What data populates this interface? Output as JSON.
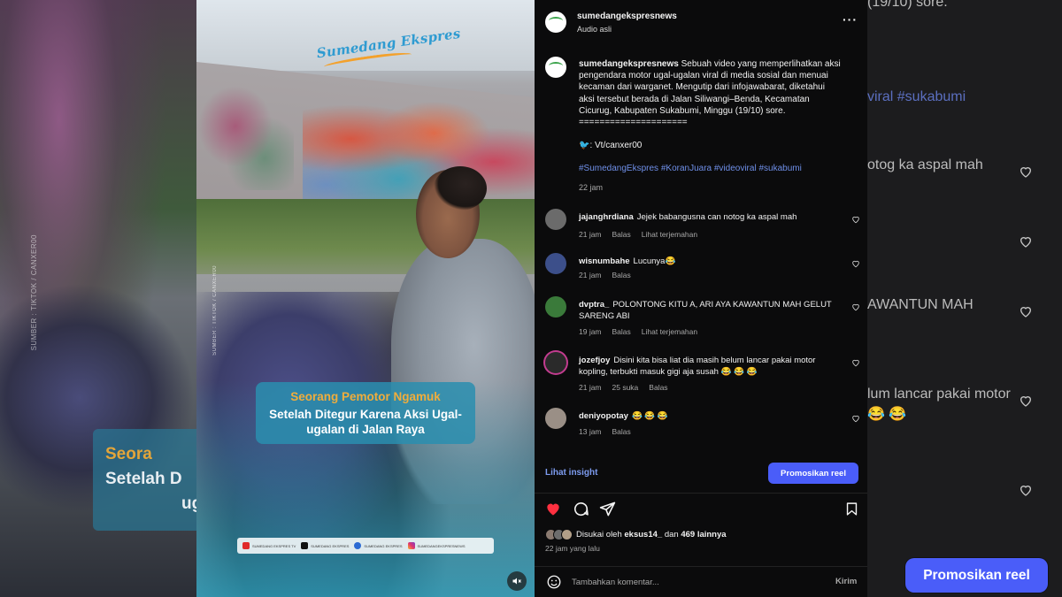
{
  "background_left": {
    "overlay_line1": "Seora",
    "overlay_line2": "Setelah D",
    "overlay_line3": "ug",
    "side_credit": "SUMBER : TIKTOK / CANXER00"
  },
  "video": {
    "brand_logo": "Sumedang Ekspres",
    "side_credit": "SUMBER : TIKTOK / CANXER00",
    "caption_title": "Seorang Pemotor Ngamuk",
    "caption_body_1": "Setelah Ditegur Karena Aksi Ugal-",
    "caption_body_2": "ugalan di Jalan Raya",
    "socials": [
      {
        "icon": "youtube-icon",
        "label": "SUMEDANG EKSPRES TV"
      },
      {
        "icon": "tiktok-icon",
        "label": "SUMEDANG EKSPRES"
      },
      {
        "icon": "facebook-icon",
        "label": "SUMEDANG EKSPRES"
      },
      {
        "icon": "instagram-icon",
        "label": "SUMEDANGEKSPRESNEWS"
      }
    ],
    "mute_icon": "speaker-muted-icon"
  },
  "header": {
    "username": "sumedangekspresnews",
    "audio": "Audio asli",
    "more": "···"
  },
  "post": {
    "username": "sumedangekspresnews",
    "caption_lines": [
      "Sebuah video yang memperlihatkan aksi",
      "pengendara motor ugal-ugalan viral di media sosial dan menuai",
      "kecaman dari warganet. Mengutip dari infojawabarat, diketahui",
      "aksi tersebut berada di Jalan Siliwangi–Benda, Kecamatan",
      "Cicurug, Kabupaten Sukabumi, Minggu (19/10) sore.",
      "====================="
    ],
    "credit": "🐦: Vt/canxer00",
    "hashtags": "#SumedangEkspres #KoranJuara #videoviral #sukabumi",
    "time": "22 jam"
  },
  "comments": [
    {
      "user": "jajanghrdiana",
      "text": "Jejek babangusna can notog ka aspal mah",
      "time": "21 jam",
      "likes": "",
      "reply": "Balas",
      "translate": "Lihat terjemahan",
      "avatar_color": "#6b6b6b"
    },
    {
      "user": "wisnumbahe",
      "text": "Lucunya😂",
      "time": "21 jam",
      "likes": "",
      "reply": "Balas",
      "translate": "",
      "avatar_color": "#3c4f8a"
    },
    {
      "user": "dvptra_",
      "text": "POLONTONG KITU A, ARI AYA KAWANTUN MAH GELUT SARENG ABI",
      "time": "19 jam",
      "likes": "",
      "reply": "Balas",
      "translate": "Lihat terjemahan",
      "avatar_color": "#3a7a3a"
    },
    {
      "user": "jozefjoy",
      "text": "Disini kita bisa liat dia masih belum lancar pakai motor kopling, terbukti masuk gigi aja susah 😂 😂 😂",
      "time": "21 jam",
      "likes": "25 suka",
      "reply": "Balas",
      "translate": "",
      "avatar_color": "#2a2a2a"
    },
    {
      "user": "deniyopotay",
      "text": "😂 😂 😂",
      "time": "13 jam",
      "likes": "",
      "reply": "Balas",
      "translate": "",
      "avatar_color": "#9a8f86"
    }
  ],
  "insight": {
    "link": "Lihat insight",
    "promote": "Promosikan reel"
  },
  "actions": {
    "like_icon": "heart-filled-icon",
    "comment_icon": "comment-icon",
    "share_icon": "send-icon",
    "save_icon": "bookmark-icon"
  },
  "likes": {
    "prefix": "Disukai oleh",
    "user": "eksus14_",
    "mid": "dan",
    "count": "469 lainnya"
  },
  "posted_ago": "22 jam yang lalu",
  "add_comment": {
    "placeholder": "Tambahkan komentar...",
    "send": "Kirim"
  },
  "background_right": {
    "line_time": "(19/10) sore.",
    "line_tags": "viral #sukabumi",
    "line_c1": "otog ka aspal mah",
    "line_c3": "AWANTUN MAH",
    "line_c4a": "lum lancar pakai motor",
    "line_c4b": "😂 😂",
    "promote": "Promosikan reel"
  },
  "colors": {
    "accent": "#4a5df9",
    "link": "#7d9cf0",
    "hashtag": "#6f8fe8",
    "like_red": "#ff3040",
    "panel_bg": "#0b0b0c"
  }
}
